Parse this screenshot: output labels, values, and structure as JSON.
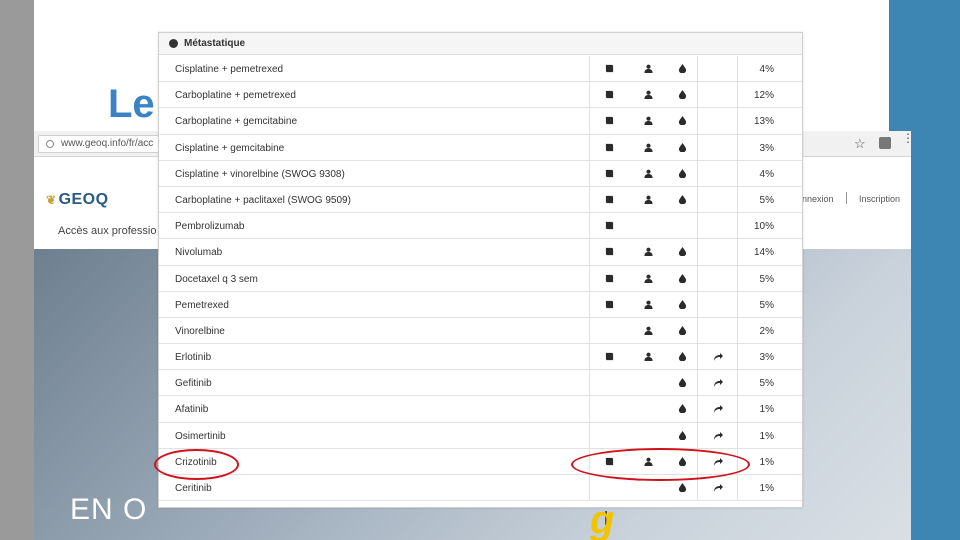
{
  "slide": {
    "title_fragment": "Le",
    "accent_color": "#3d86b3",
    "title_color": "#3b83c4"
  },
  "browser": {
    "url": "www.geoq.info/fr/acc",
    "logo_text": "GEOQ",
    "tagline": "Accès aux professio",
    "connexion_label": "nnexion",
    "inscription_label": "Inscription",
    "hero_text": "EN O",
    "icons": [
      "lock-icon",
      "star-icon",
      "extension-icon",
      "menu-icon"
    ]
  },
  "panel": {
    "title": "Métastatique",
    "header_icon": "circle-icon",
    "rows": [
      {
        "name": "Cisplatine + pemetrexed",
        "book": true,
        "person": true,
        "drop": true,
        "arrow": false,
        "pct": "4%"
      },
      {
        "name": "Carboplatine + pemetrexed",
        "book": true,
        "person": true,
        "drop": true,
        "arrow": false,
        "pct": "12%"
      },
      {
        "name": "Carboplatine + gemcitabine",
        "book": true,
        "person": true,
        "drop": true,
        "arrow": false,
        "pct": "13%"
      },
      {
        "name": "Cisplatine + gemcitabine",
        "book": true,
        "person": true,
        "drop": true,
        "arrow": false,
        "pct": "3%"
      },
      {
        "name": "Cisplatine + vinorelbine (SWOG 9308)",
        "book": true,
        "person": true,
        "drop": true,
        "arrow": false,
        "pct": "4%"
      },
      {
        "name": "Carboplatine + paclitaxel (SWOG 9509)",
        "book": true,
        "person": true,
        "drop": true,
        "arrow": false,
        "pct": "5%"
      },
      {
        "name": "Pembrolizumab",
        "book": true,
        "person": false,
        "drop": false,
        "arrow": false,
        "pct": "10%"
      },
      {
        "name": "Nivolumab",
        "book": true,
        "person": true,
        "drop": true,
        "arrow": false,
        "pct": "14%"
      },
      {
        "name": "Docetaxel q 3 sem",
        "book": true,
        "person": true,
        "drop": true,
        "arrow": false,
        "pct": "5%"
      },
      {
        "name": "Pemetrexed",
        "book": true,
        "person": true,
        "drop": true,
        "arrow": false,
        "pct": "5%"
      },
      {
        "name": "Vinorelbine",
        "book": false,
        "person": true,
        "drop": true,
        "arrow": false,
        "pct": "2%"
      },
      {
        "name": "Erlotinib",
        "book": true,
        "person": true,
        "drop": true,
        "arrow": true,
        "pct": "3%"
      },
      {
        "name": "Gefitinib",
        "book": false,
        "person": false,
        "drop": true,
        "arrow": true,
        "pct": "5%"
      },
      {
        "name": "Afatinib",
        "book": false,
        "person": false,
        "drop": true,
        "arrow": true,
        "pct": "1%"
      },
      {
        "name": "Osimertinib",
        "book": false,
        "person": false,
        "drop": true,
        "arrow": true,
        "pct": "1%"
      },
      {
        "name": "Crizotinib",
        "book": true,
        "person": true,
        "drop": true,
        "arrow": true,
        "pct": "1%"
      },
      {
        "name": "Ceritinib",
        "book": false,
        "person": false,
        "drop": true,
        "arrow": true,
        "pct": "1%"
      }
    ]
  },
  "annotation": {
    "color": "#d0121b",
    "highlighted_row": "Crizotinib"
  }
}
